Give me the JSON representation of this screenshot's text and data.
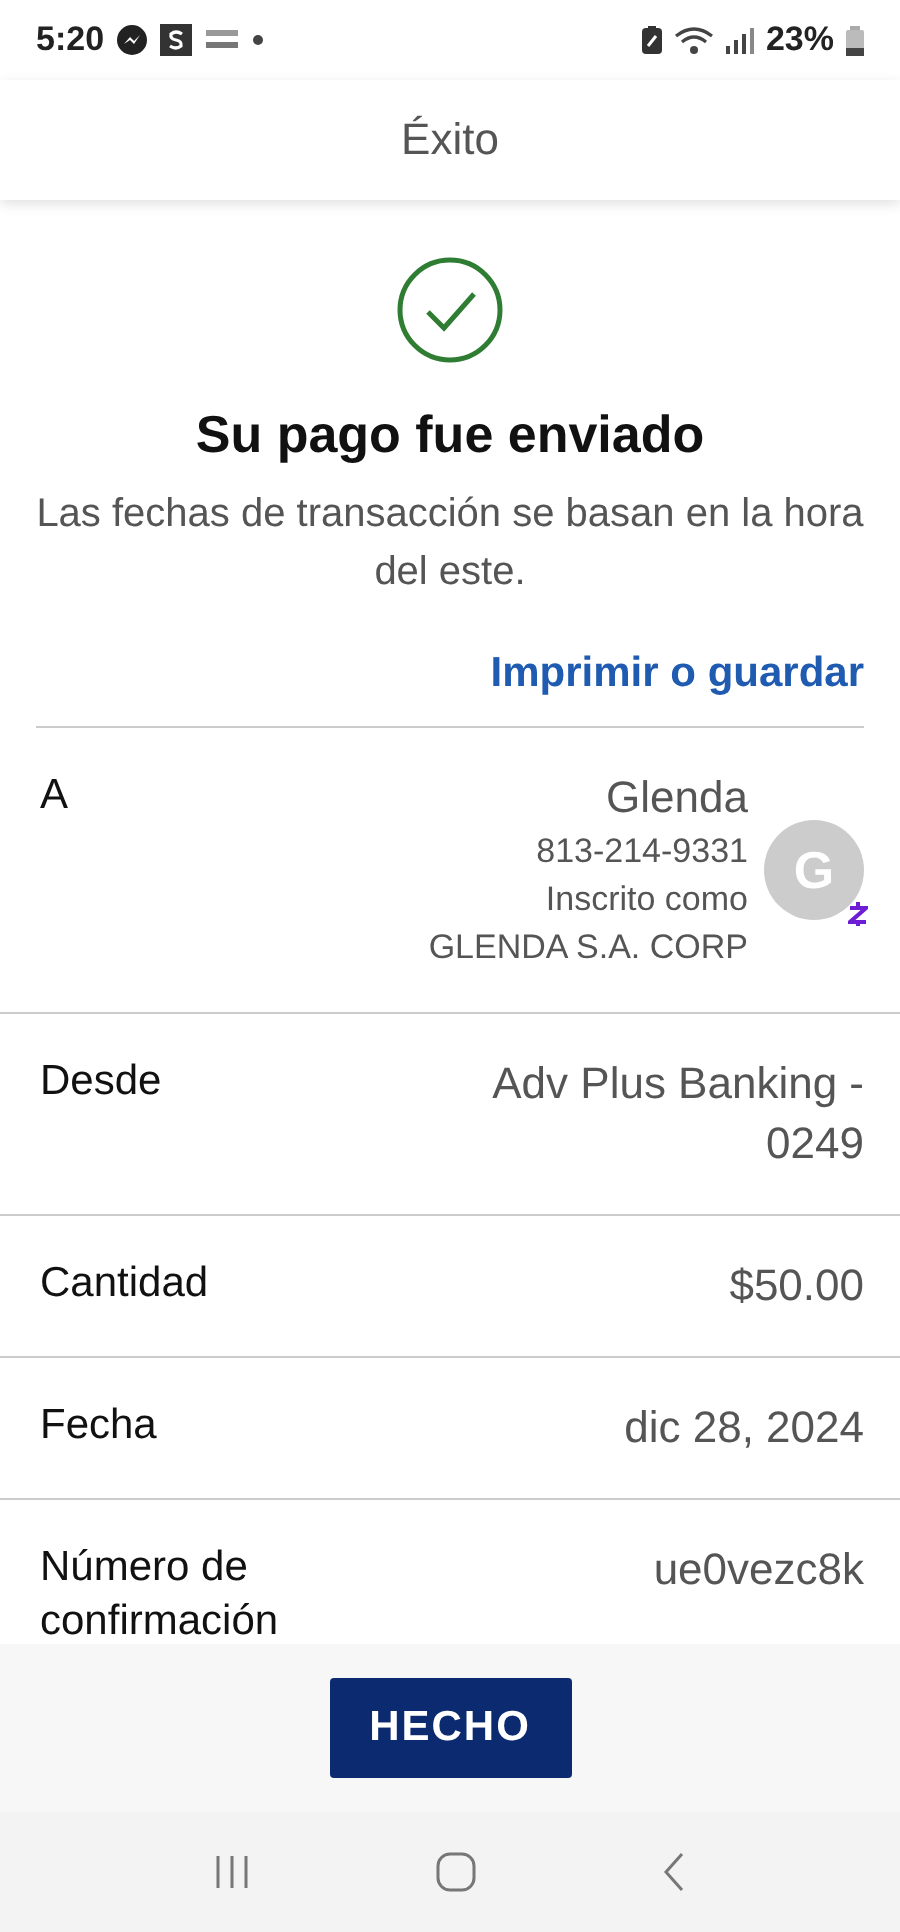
{
  "status_bar": {
    "time": "5:20",
    "battery": "23%"
  },
  "header": {
    "title": "Éxito"
  },
  "success": {
    "title": "Su pago fue enviado",
    "message": "Las fechas de transacción se basan en la hora del este.",
    "link": "Imprimir o guardar"
  },
  "details": [
    {
      "kind": "recipient",
      "label": "A",
      "name": "Glenda",
      "phone": "813-214-9331",
      "enrolled_label": "Inscrito como",
      "enrolled_name": "GLENDA S.A. CORP",
      "avatar": "G"
    },
    {
      "kind": "plain",
      "label": "Desde",
      "value": "Adv Plus Banking - 0249"
    },
    {
      "kind": "plain",
      "label": "Cantidad",
      "value": "$50.00"
    },
    {
      "kind": "plain",
      "label": "Fecha",
      "value": "dic 28, 2024"
    },
    {
      "kind": "plain",
      "label": "Número de confirmación",
      "value": "ue0vezc8k"
    }
  ],
  "footer": {
    "button": "HECHO"
  }
}
